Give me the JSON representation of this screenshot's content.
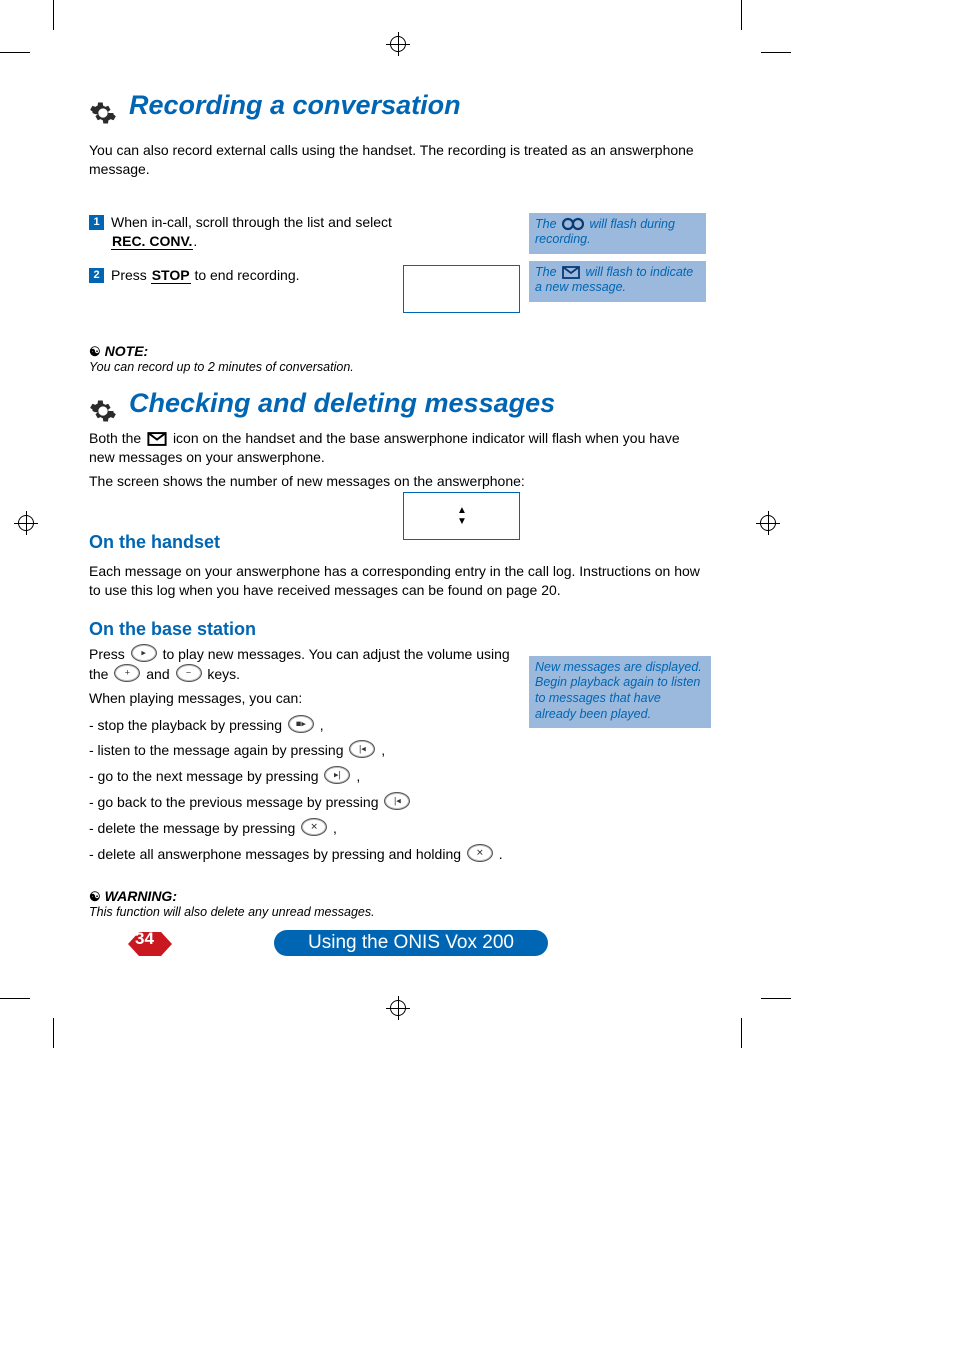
{
  "headings": {
    "h1a": "Recording a conversation",
    "h1b": "Checking and deleting messages",
    "h2a": "On the handset",
    "h2b": "On the base station"
  },
  "intro": "You can also record external calls using the handset. The recording is treated as an answerphone message.",
  "steps": {
    "s1a": "When in-call, scroll through the list and select ",
    "s1b_box": "REC. CONV.",
    "s1c": ".",
    "s2a": "Press ",
    "s2b_box": "STOP",
    "s2c": " to end recording."
  },
  "info": {
    "i1a": "The ",
    "i1b": " will flash during recording.",
    "i2a": "The ",
    "i2b": " will flash to indicate a new message."
  },
  "note": {
    "head": "NOTE:",
    "body": "You can record up to 2 minutes of conversation."
  },
  "body2": {
    "p1a": "Both the ",
    "p1b": " icon on the handset and the base answerphone indicator will flash when you have new messages on your answerphone.",
    "p2": "The screen shows the number of new messages on the answerphone:",
    "p3": "Each message on your answerphone has a corresponding entry in the call log. Instructions on how to use this log when you have received messages can be found on page 20.",
    "p4a": "Press ",
    "p4b": " to play new messages. You can adjust the volume using the ",
    "p4c": " and ",
    "p4d": " keys.",
    "p5": "When playing messages, you can:",
    "b1": "- stop the playback by pressing ",
    "b1e": " ,",
    "b2": "- listen to the message again by pressing ",
    "b2e": " ,",
    "b3": "- go to the next message by pressing ",
    "b3e": " ,",
    "b4": "- go back to the previous message by pressing ",
    "b5": "- delete the message by pressing ",
    "b5e": " ,",
    "b6": "- delete all answerphone messages by pressing and holding ",
    "b6e": " ."
  },
  "side_msg": "New messages are displayed. Begin playback again to listen to messages that have already been played.",
  "warn": {
    "head": "WARNING:",
    "body": "This function will also delete any unread messages."
  },
  "footer": {
    "page_num": "34",
    "title": "Using the ONIS Vox 200"
  }
}
